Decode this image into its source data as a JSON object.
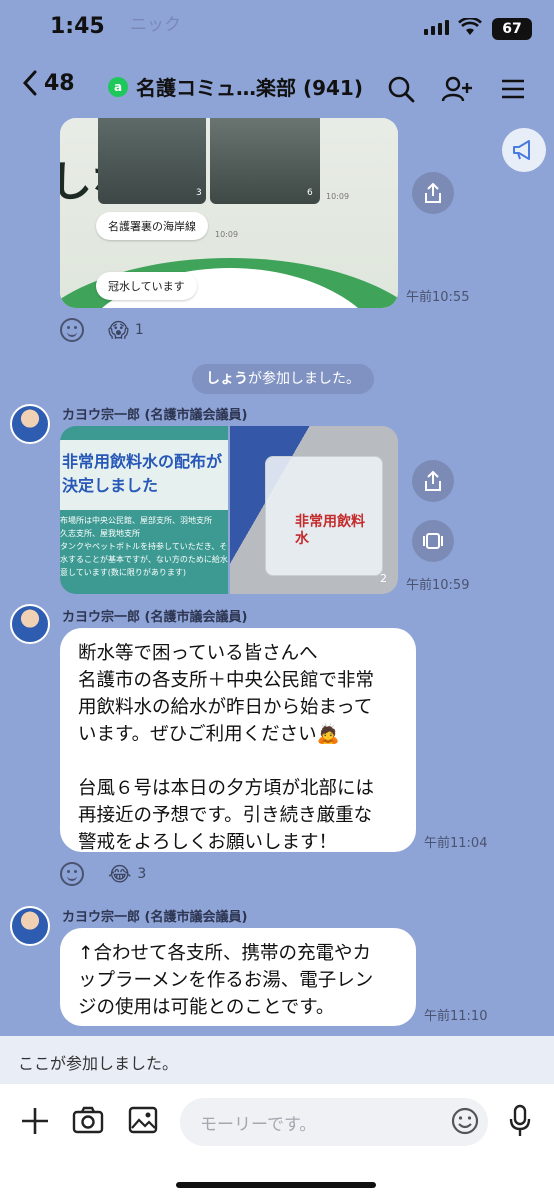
{
  "status": {
    "time": "1:45",
    "battery": "67",
    "ghost_banner": "ニック"
  },
  "header": {
    "back_count": "48",
    "badge": "a",
    "title": "名護コミュ…楽部 (941)"
  },
  "messages": {
    "image_post": {
      "caption1": "名護署裏の海岸線",
      "caption2": "冠水しています",
      "img_count1": "3",
      "img_count2": "6",
      "inner_time": "10:09",
      "inner_time2": "10:09",
      "time": "午前10:55",
      "reaction_count": "1"
    },
    "system_join": {
      "name": "しょう",
      "suffix": "が参加しました。"
    },
    "post2": {
      "sender": "カヨウ宗一郎 (名護市議会議員)",
      "poster_title": "非常用飲料水の配布が決定しました",
      "poster_lines": [
        "布場所は中央公民館、屋部支所、羽地支所",
        "久志支所、屋我地支所",
        "タンクやペットボトルを持参していただき、そ",
        "水することが基本ですが、ない方のために給水",
        "意しています(数に限りがあります)"
      ],
      "bag_label": "非常用飲料水",
      "img_count": "2",
      "time": "午前10:59"
    },
    "post3": {
      "sender": "カヨウ宗一郎 (名護市議会議員)",
      "lines": [
        "断水等で困っている皆さんへ",
        "名護市の各支所＋中央公民館で非常",
        "用飲料水の給水が昨日から始まって",
        "います。ぜひご利用ください🙇",
        "",
        "台風６号は本日の夕方頃が北部には",
        "再接近の予想です。引き続き厳重な",
        "警戒をよろしくお願いします！"
      ],
      "time": "午前11:04",
      "reaction_count": "3"
    },
    "post4": {
      "sender": "カヨウ宗一郎 (名護市議会議員)",
      "lines": [
        "↑合わせて各支所、携帯の充電やカ",
        "ップラーメンを作るお湯、電子レン",
        "ジの使用は可能とのことです。"
      ],
      "time": "午前11:10"
    }
  },
  "system_strip": "ここが参加しました。",
  "input": {
    "placeholder": "モーリーです。"
  },
  "colors": {
    "background": "#8ea3d6",
    "bubble": "#ffffff",
    "accent_green": "#1ec85a"
  }
}
